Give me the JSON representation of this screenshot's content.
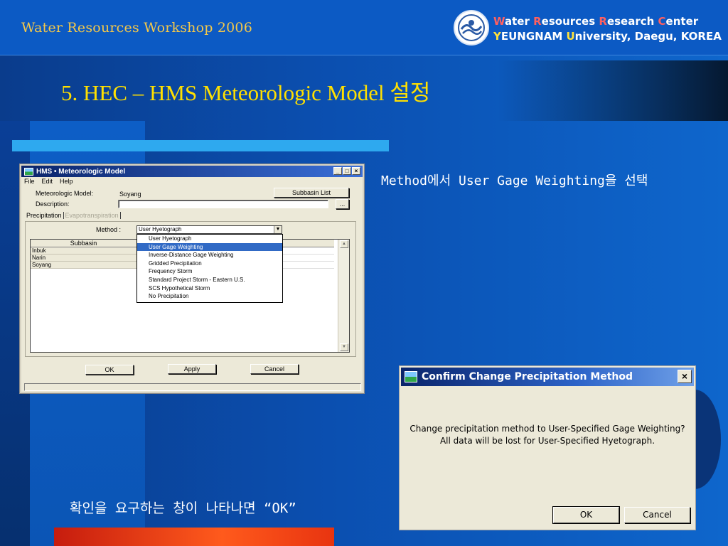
{
  "header": {
    "workshop_title": "Water Resources Workshop 2006",
    "center_line1_parts": [
      "W",
      "ater  ",
      "R",
      "esources  ",
      "R",
      "esearch  ",
      "C",
      "enter"
    ],
    "center_line2_parts": [
      "Y",
      "EUNGNAM ",
      "U",
      "niversity, Daegu, KOREA"
    ],
    "logo_icon": "university-seal-icon"
  },
  "slide": {
    "title": "5. HEC – HMS Meteorologic Model  설정",
    "caption_method": "Method에서 User Gage Weighting을 선택",
    "caption_confirm": "확인을 요구하는 창이 나타나면  “OK”"
  },
  "hms_window": {
    "title": "HMS • Meteorologic Model",
    "menu": [
      "File",
      "Edit",
      "Help"
    ],
    "meteorologic_model_label": "Meteorologic Model:",
    "meteorologic_model_value": "Soyang",
    "description_label": "Description:",
    "subbasin_list_button": "Subbasin List",
    "ellipsis_button": "...",
    "tabs": [
      "Precipitation",
      "Evapotranspiration"
    ],
    "method_label": "Method :",
    "method_value": "User Hyetograph",
    "table_header": "Subbasin",
    "rows": [
      "Inbuk",
      "Narin",
      "Soyang"
    ],
    "dropdown_options": [
      "User Hyetograph",
      "User Gage Weighting",
      "Inverse-Distance Gage Weighting",
      "Gridded Precipitation",
      "Frequency Storm",
      "Standard Project Storm - Eastern U.S.",
      "SCS Hypothetical Storm",
      "No Precipitation"
    ],
    "selected_option_index": 1,
    "ok_button": "OK",
    "apply_button": "Apply",
    "cancel_button": "Cancel"
  },
  "confirm_dialog": {
    "title": "Confirm Change Precipitation Method",
    "close_glyph": "×",
    "message_line1": "Change precipitation method to User-Specified Gage Weighting?",
    "message_line2": "All data will be lost for User-Specified Hyetograph.",
    "ok_button": "OK",
    "cancel_button": "Cancel"
  },
  "colors": {
    "title_yellow": "#ffe000",
    "workshop_gold": "#f3c84a",
    "accent_red": "#ff6060",
    "accent_yellow": "#ffe23a",
    "selection_blue": "#316ac5"
  }
}
